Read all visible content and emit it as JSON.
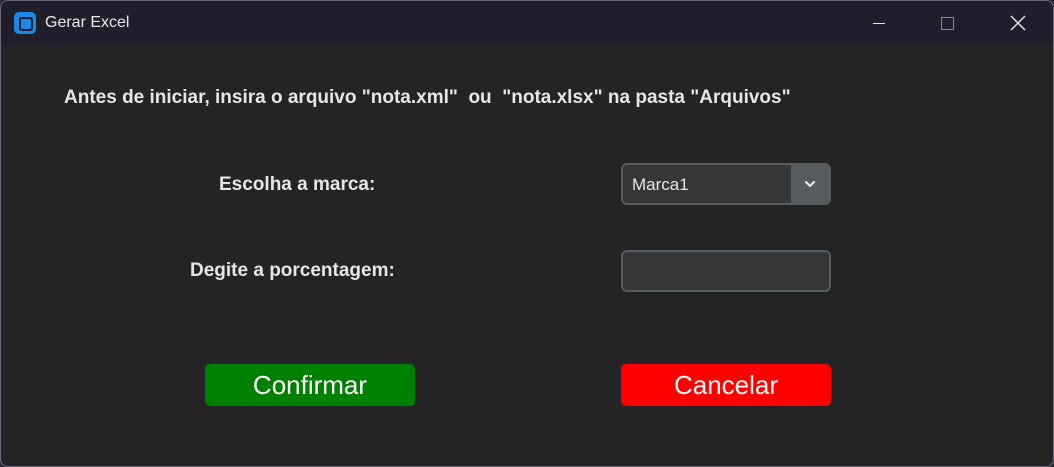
{
  "window": {
    "title": "Gerar Excel",
    "icon": "app-icon",
    "controls": {
      "minimize_icon": "minimize-icon",
      "maximize_icon": "maximize-icon",
      "close_icon": "close-icon"
    }
  },
  "main": {
    "instruction": "Antes de iniciar, insira o arquivo \"nota.xml\"  ou  \"nota.xlsx\" na pasta \"Arquivos\"",
    "marca_label": "Escolha a marca:",
    "marca_selected": "Marca1",
    "porcentagem_label": "Degite a porcentagem:",
    "porcentagem_value": "",
    "confirm_label": "Confirmar",
    "cancel_label": "Cancelar"
  },
  "colors": {
    "background": "#242424",
    "titlebar": "#1f1e2b",
    "confirm": "#008000",
    "cancel": "#ff0000",
    "field": "#343638",
    "field_border": "#565b5e"
  }
}
